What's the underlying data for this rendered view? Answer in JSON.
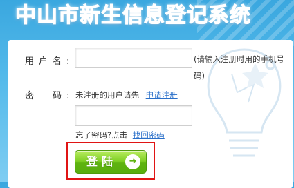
{
  "page": {
    "title": "中山市新生信息登记系统"
  },
  "form": {
    "username_label": "用户名:",
    "username_value": "",
    "username_hint": "(请输入注册时用的手机号码)",
    "password_label": "密　码:",
    "register_prompt": "未注册的用户请先",
    "register_link": "申请注册",
    "password_value": "",
    "forgot_prompt": "忘了密码?点击",
    "forgot_link": "找回密码",
    "login_label": "登陆",
    "login_icon": "arrow-right-icon"
  },
  "colors": {
    "accent": "#3aa7df",
    "button": "#6cc21a",
    "highlight": "#e01414",
    "link": "#2a6fc9"
  }
}
